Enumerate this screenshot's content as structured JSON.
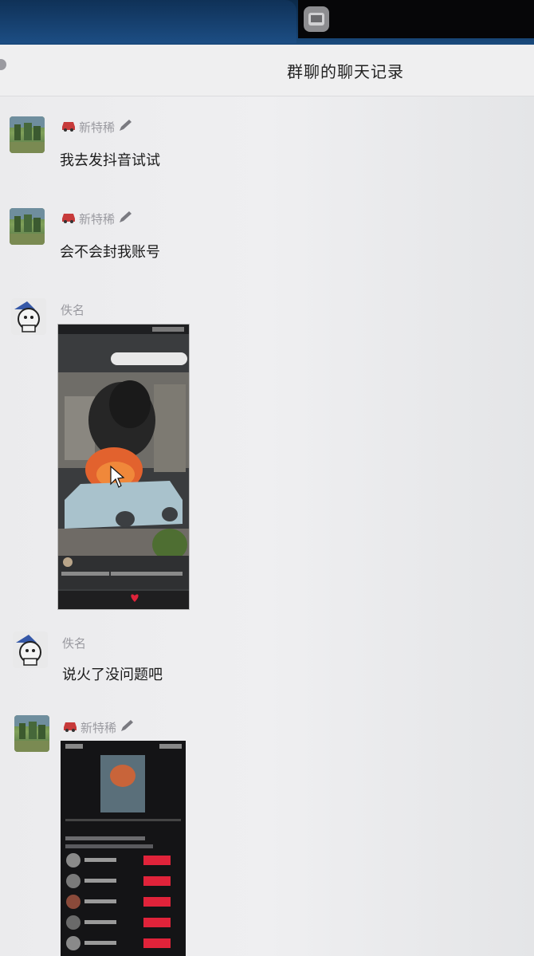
{
  "header": {
    "title": "群聊的聊天记录"
  },
  "messages": [
    {
      "sender": "新特稀",
      "text": "我去发抖音试试"
    },
    {
      "sender": "新特稀",
      "text": "会不会封我账号"
    },
    {
      "sender": "佚名"
    },
    {
      "sender": "佚名",
      "text": "说火了没问题吧"
    },
    {
      "sender": "新特稀"
    }
  ]
}
